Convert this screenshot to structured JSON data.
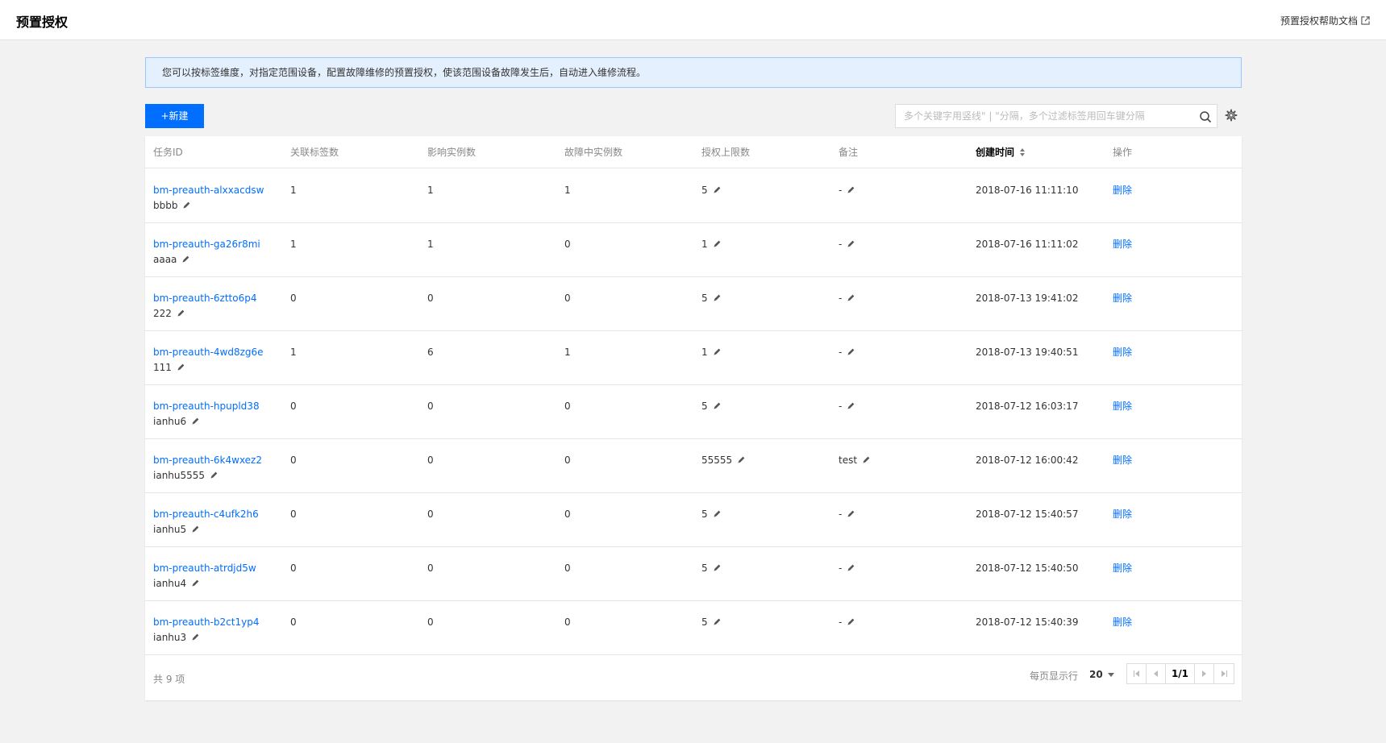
{
  "header": {
    "title": "预置授权",
    "help_link": "预置授权帮助文档"
  },
  "notice": "您可以按标签维度，对指定范围设备，配置故障维修的预置授权，使该范围设备故障发生后，自动进入维修流程。",
  "toolbar": {
    "new_button": "+新建",
    "search_placeholder": "多个关键字用竖线\" | \"分隔，多个过滤标签用回车键分隔"
  },
  "table": {
    "columns": [
      "任务ID",
      "关联标签数",
      "影响实例数",
      "故障中实例数",
      "授权上限数",
      "备注",
      "创建时间",
      "操作"
    ],
    "rows": [
      {
        "id": "bm-preauth-alxxacdsw",
        "name": "bbbb",
        "tags": "1",
        "affected": "1",
        "faulty": "1",
        "limit": "5",
        "remark": "-",
        "created": "2018-07-16 11:11:10",
        "action": "删除"
      },
      {
        "id": "bm-preauth-ga26r8mi",
        "name": "aaaa",
        "tags": "1",
        "affected": "1",
        "faulty": "0",
        "limit": "1",
        "remark": "-",
        "created": "2018-07-16 11:11:02",
        "action": "删除"
      },
      {
        "id": "bm-preauth-6ztto6p4",
        "name": "222",
        "tags": "0",
        "affected": "0",
        "faulty": "0",
        "limit": "5",
        "remark": "-",
        "created": "2018-07-13 19:41:02",
        "action": "删除"
      },
      {
        "id": "bm-preauth-4wd8zg6e",
        "name": "111",
        "tags": "1",
        "affected": "6",
        "faulty": "1",
        "limit": "1",
        "remark": "-",
        "created": "2018-07-13 19:40:51",
        "action": "删除"
      },
      {
        "id": "bm-preauth-hpupld38",
        "name": "ianhu6",
        "tags": "0",
        "affected": "0",
        "faulty": "0",
        "limit": "5",
        "remark": "-",
        "created": "2018-07-12 16:03:17",
        "action": "删除"
      },
      {
        "id": "bm-preauth-6k4wxez2",
        "name": "ianhu5555",
        "tags": "0",
        "affected": "0",
        "faulty": "0",
        "limit": "55555",
        "remark": "test",
        "created": "2018-07-12 16:00:42",
        "action": "删除"
      },
      {
        "id": "bm-preauth-c4ufk2h6",
        "name": "ianhu5",
        "tags": "0",
        "affected": "0",
        "faulty": "0",
        "limit": "5",
        "remark": "-",
        "created": "2018-07-12 15:40:57",
        "action": "删除"
      },
      {
        "id": "bm-preauth-atrdjd5w",
        "name": "ianhu4",
        "tags": "0",
        "affected": "0",
        "faulty": "0",
        "limit": "5",
        "remark": "-",
        "created": "2018-07-12 15:40:50",
        "action": "删除"
      },
      {
        "id": "bm-preauth-b2ct1yp4",
        "name": "ianhu3",
        "tags": "0",
        "affected": "0",
        "faulty": "0",
        "limit": "5",
        "remark": "-",
        "created": "2018-07-12 15:40:39",
        "action": "删除"
      }
    ]
  },
  "footer": {
    "total": "共 9 项",
    "per_page_label": "每页显示行",
    "per_page_value": "20",
    "page_indicator": "1/1"
  },
  "colors": {
    "accent": "#006eff",
    "notice_bg": "#e5f0ff",
    "notice_border": "#97c7ff"
  },
  "icons": [
    "external-link-icon",
    "search-icon",
    "gear-icon",
    "sort-icon",
    "pencil-edit-icon",
    "first-page-icon",
    "prev-page-icon",
    "next-page-icon",
    "last-page-icon"
  ]
}
